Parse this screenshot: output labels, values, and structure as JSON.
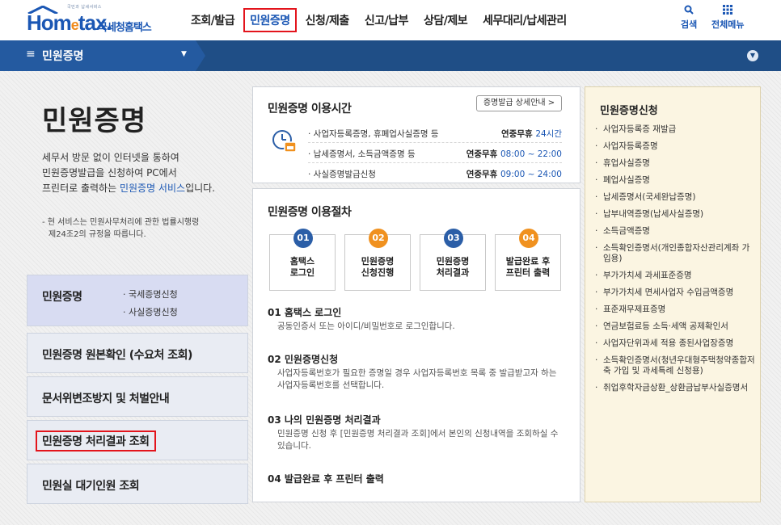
{
  "header": {
    "logo_slogan": "국민과 납세서비스",
    "logo_brand": "Hometax",
    "logo_korean": "국세청홈택스",
    "nav": [
      "조회/발급",
      "민원증명",
      "신청/제출",
      "신고/납부",
      "상담/제보",
      "세무대리/납세관리"
    ],
    "active_nav": "민원증명",
    "search_label": "검색",
    "allmenu_label": "전체메뉴"
  },
  "subnav": {
    "current": "민원증명"
  },
  "left": {
    "title": "민원증명",
    "desc_1": "세무서 방문 없이 인터넷을 통하여",
    "desc_2": "민원증명발급을 신청하여 PC에서",
    "desc_3a": "프린터로 출력하는 ",
    "desc_3b": "민원증명 서비스",
    "desc_3c": "입니다.",
    "note_1": "- 현 서비스는 민원사무처리에 관한 법률시행령",
    "note_2": "  제24조2의 규정을 따릅니다.",
    "menus": {
      "m1": "민원증명",
      "m1_sub1": "· 국세증명신청",
      "m1_sub2": "· 사실증명신청",
      "m2": "민원증명 원본확인 (수요처 조회)",
      "m3": "문서위변조방지 및 처벌안내",
      "m4": "민원증명 처리결과 조회",
      "m5": "민원실 대기인원 조회"
    }
  },
  "hours": {
    "title": "민원증명 이용시간",
    "detail_btn": "증명발급 상세안내 >",
    "rows": [
      {
        "label": "· 사업자등록증명, 휴폐업사실증명 등",
        "val_a": "연중무휴 ",
        "val_b": "24시간"
      },
      {
        "label": "· 납세증명서, 소득금액증명 등",
        "val_a": "연중무휴 ",
        "val_b": "08:00 ~ 22:00"
      },
      {
        "label": "· 사실증명발급신청",
        "val_a": "연중무휴 ",
        "val_b": "09:00 ~ 24:00"
      }
    ]
  },
  "procedure": {
    "title": "민원증명 이용절차",
    "steps": [
      {
        "num": "01",
        "line1": "홈택스",
        "line2": "로그인"
      },
      {
        "num": "02",
        "line1": "민원증명",
        "line2": "신청진행"
      },
      {
        "num": "03",
        "line1": "민원증명",
        "line2": "처리결과"
      },
      {
        "num": "04",
        "line1": "발급완료 후",
        "line2": "프린터 출력"
      }
    ],
    "items": [
      {
        "title": "01 홈택스 로그인",
        "text": "공동인증서 또는 아이디/비밀번호로 로그인합니다."
      },
      {
        "title": "02 민원증명신청",
        "text": "사업자등록번호가 필요한 증명일 경우 사업자등록번호 목록 중 발급받고자 하는 사업자등록번호를 선택합니다."
      },
      {
        "title": "03 나의 민원증명 처리결과",
        "text": "민원증명 신청 후 [민원증명 처리결과 조회]에서 본인의 신청내역을 조회하실 수 있습니다."
      },
      {
        "title": "04 발급완료 후 프린터 출력",
        "text": ""
      }
    ]
  },
  "apply": {
    "title": "민원증명신청",
    "items": [
      "사업자등록증 재발급",
      "사업자등록증명",
      "휴업사실증명",
      "폐업사실증명",
      "납세증명서(국세완납증명)",
      "납부내역증명(납세사실증명)",
      "소득금액증명",
      "소득확인증명서(개인종합자산관리계좌 가입용)",
      "부가가치세 과세표준증명",
      "부가가치세 면세사업자 수입금액증명",
      "표준재무제표증명",
      "연금보험료등 소득·세액 공제확인서",
      "사업자단위과세 적용 종된사업장증명",
      "소득확인증명서(청년우대형주택청약종합저축 가입 및 과세특례 신청용)",
      "취업후학자금상환_상환금납부사실증명서"
    ]
  },
  "colors": {
    "brand": "#1b57b4",
    "highlight": "#e3141c",
    "accent": "#f0911f",
    "nav_bar": "#1f4e86"
  }
}
